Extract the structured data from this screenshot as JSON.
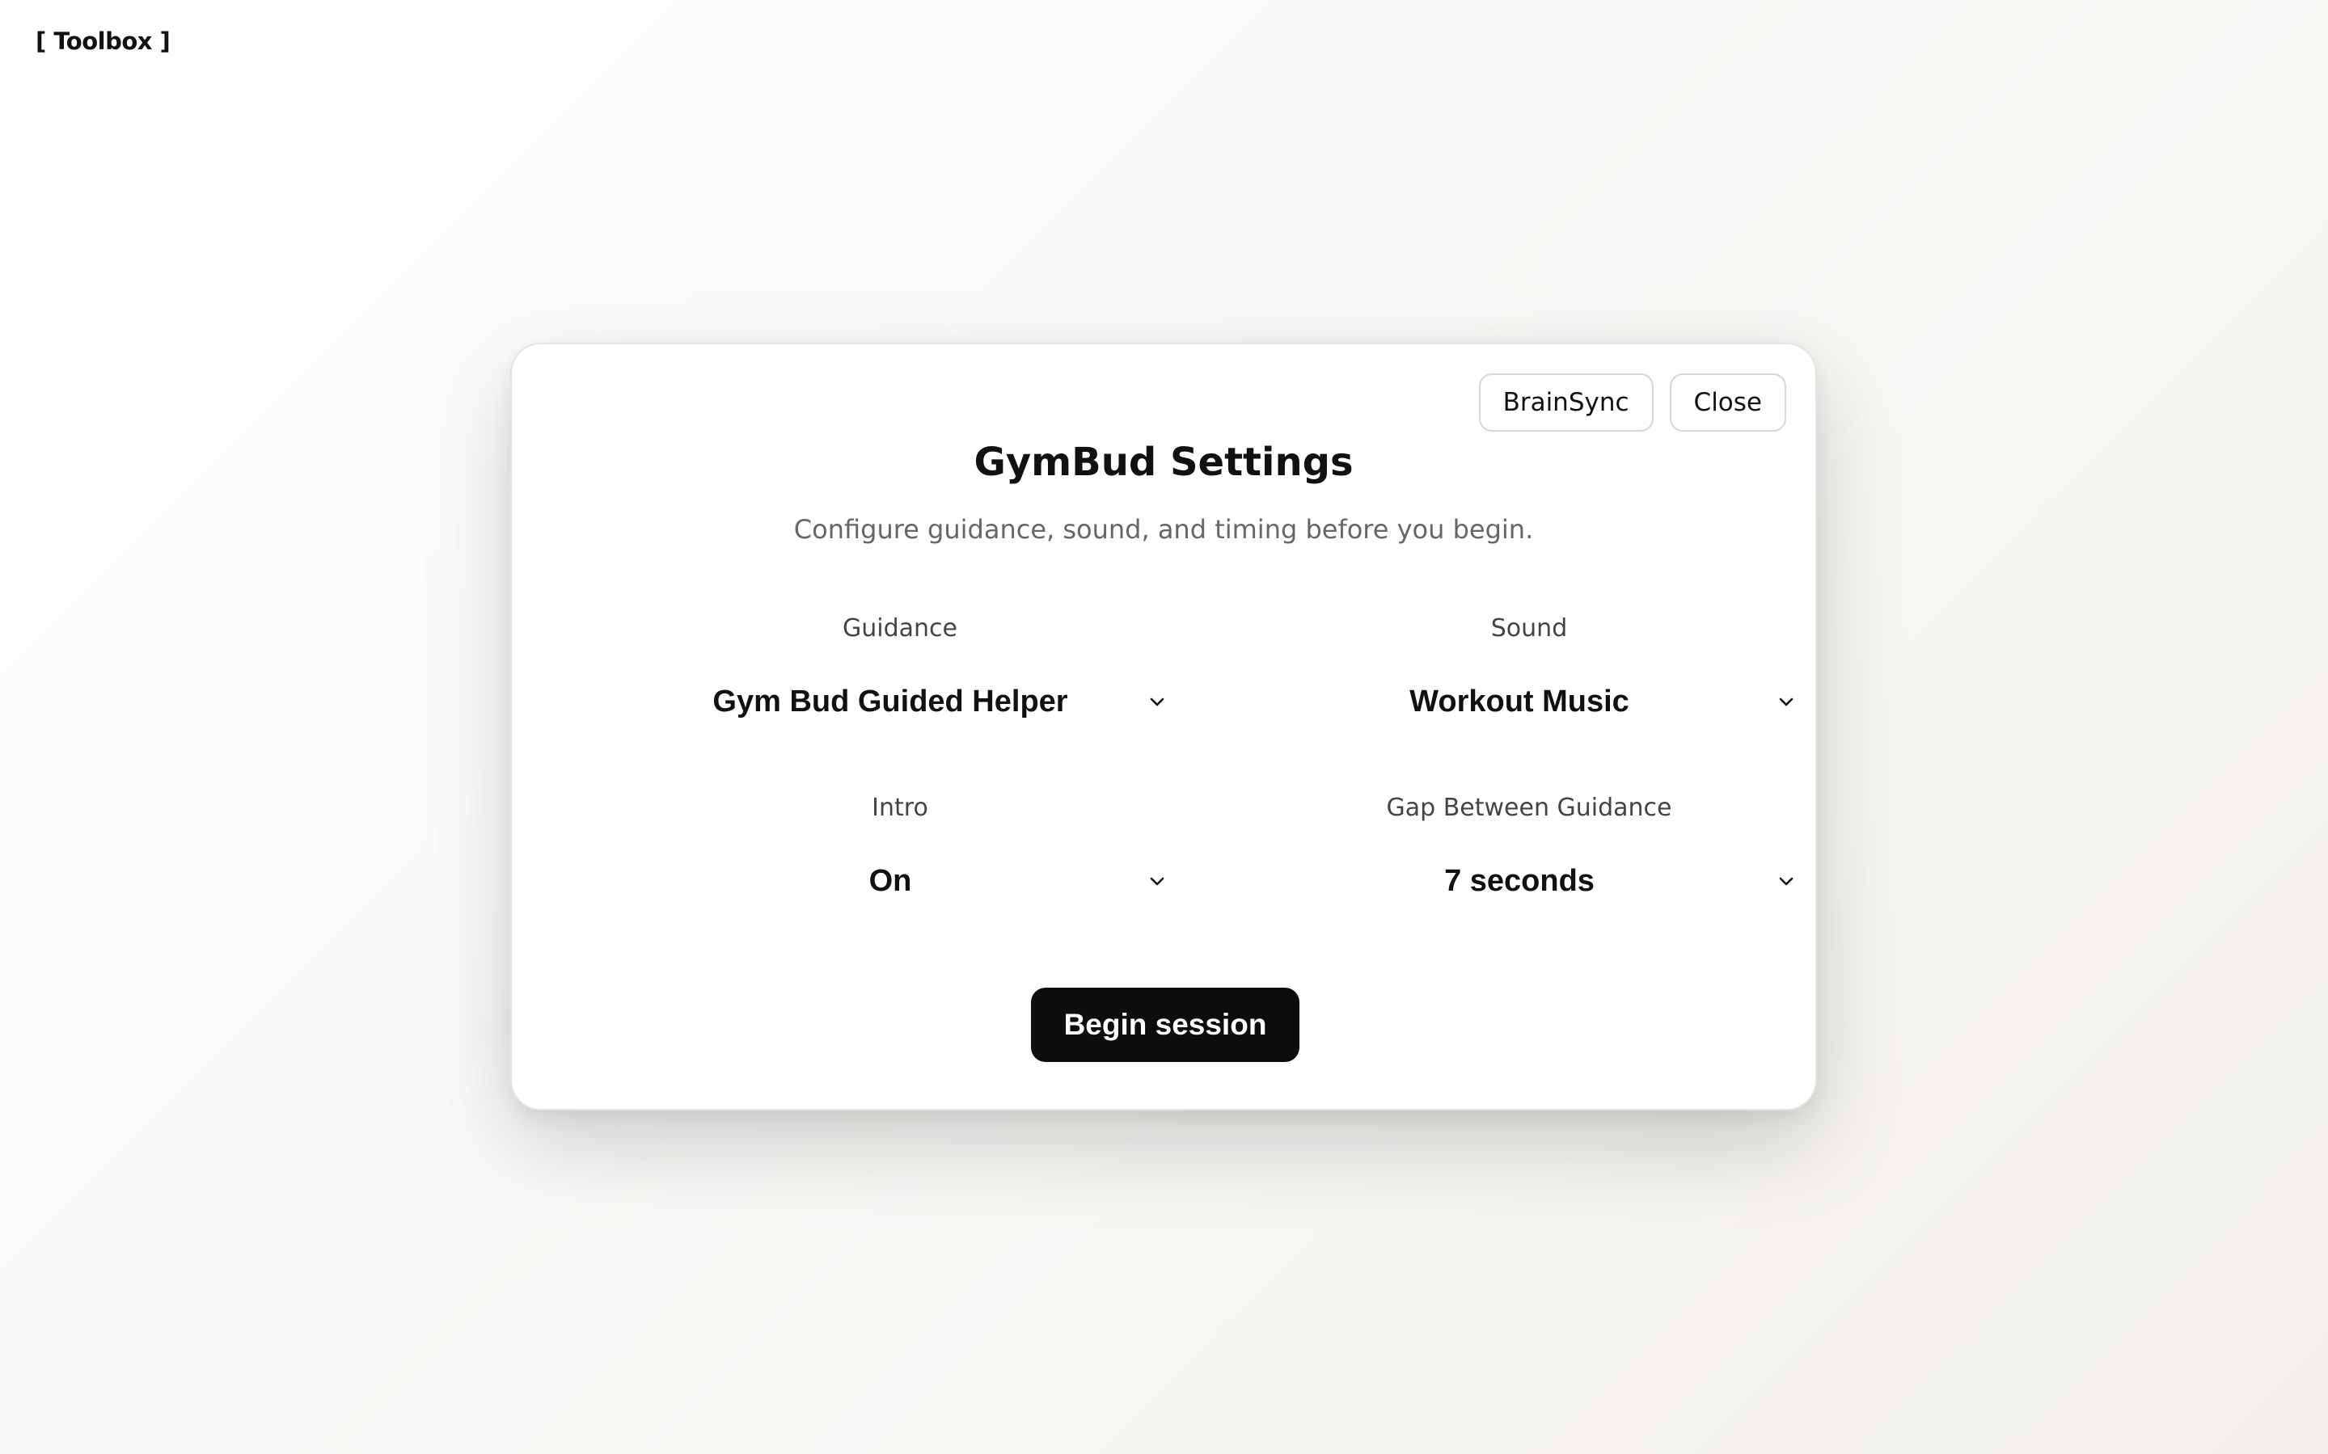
{
  "toolbox": {
    "label": "[ Toolbox ]"
  },
  "dialog": {
    "title": "GymBud Settings",
    "subtitle": "Configure guidance, sound, and timing before you begin.",
    "actions": {
      "brainsync_label": "BrainSync",
      "close_label": "Close"
    },
    "fields": {
      "guidance": {
        "label": "Guidance",
        "value": "Gym Bud Guided Helper"
      },
      "sound": {
        "label": "Sound",
        "value": "Workout Music"
      },
      "intro": {
        "label": "Intro",
        "value": "On"
      },
      "gap": {
        "label": "Gap Between Guidance",
        "value": "7 seconds"
      }
    },
    "begin_label": "Begin session"
  },
  "icons": {
    "dropdown": "chevron-down-icon"
  },
  "colors": {
    "primary_button": "#0d0d0d",
    "background": "#faf9f7",
    "card": "#ffffff",
    "muted_text": "#666666"
  }
}
